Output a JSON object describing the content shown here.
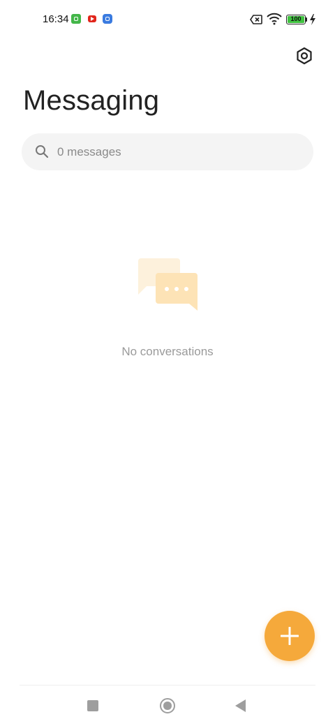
{
  "status_bar": {
    "time": "16:34",
    "notifications": [
      "android-app-icon",
      "youtube-icon",
      "messaging-app-icon"
    ],
    "battery_level": "100",
    "icons": [
      "sim-disabled-icon",
      "wifi-icon",
      "battery-icon",
      "charging-bolt-icon"
    ]
  },
  "header": {
    "title": "Messaging",
    "settings_icon": "gear-hexagon-icon"
  },
  "search": {
    "placeholder": "0 messages",
    "icon": "search-icon"
  },
  "empty_state": {
    "icon": "chat-bubbles-icon",
    "text": "No conversations"
  },
  "fab": {
    "icon": "plus-icon",
    "color": "#f5a93b"
  },
  "nav_bar": {
    "buttons": [
      "recents-button",
      "home-button",
      "back-button"
    ]
  },
  "colors": {
    "accent": "#f5a93b",
    "illustration_light": "#fdf1dc",
    "illustration_dark": "#fde3b6"
  }
}
